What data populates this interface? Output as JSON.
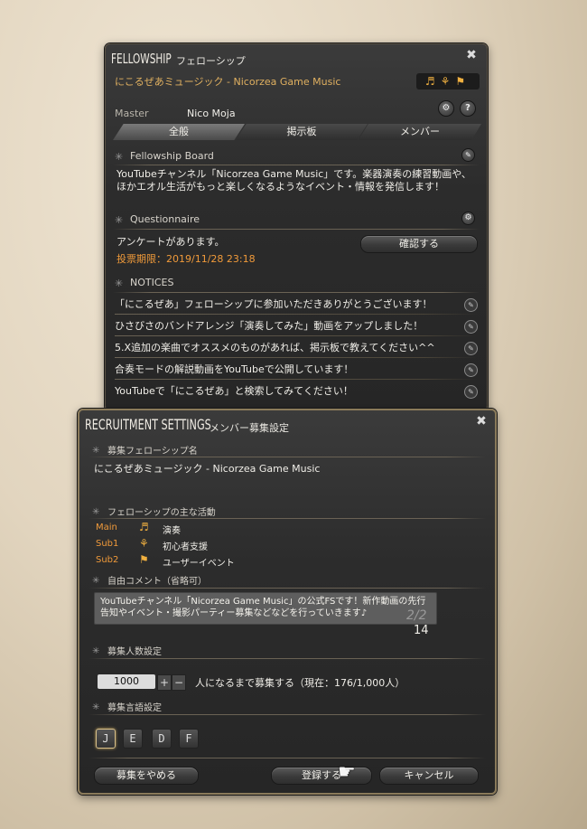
{
  "fellowship": {
    "title": "FELLOWSHIP",
    "title_jp": "フェローシップ",
    "name": "にこるぜあミュージック - Nicorzea Game Music",
    "master_label": "Master",
    "master_name": "Nico Moja",
    "tabs": [
      {
        "label": "全般",
        "active": true
      },
      {
        "label": "掲示板",
        "active": false
      },
      {
        "label": "メンバー",
        "active": false
      }
    ],
    "board": {
      "header": "Fellowship Board",
      "text": "YouTubeチャンネル「Nicorzea Game Music」です。楽器演奏の練習動画や、ほかエオル生活がもっと楽しくなるようなイベント・情報を発信します！"
    },
    "questionnaire": {
      "header": "Questionnaire",
      "text": "アンケートがあります。",
      "deadline": "投票期限：2019/11/28 23:18",
      "confirm_label": "確認する"
    },
    "notices": {
      "header": "NOTICES",
      "items": [
        "「にこるぜあ」フェローシップに参加いただきありがとうございます！",
        "ひさびさのバンドアレンジ「演奏してみた」動画をアップしました！",
        "5.X追加の楽曲でオススメのものがあれば、掲示板で教えてください^^",
        "合奏モードの解説動画をYouTubeで公開しています！",
        "YouTubeで「にこるぜあ」と検索してみてください！"
      ]
    }
  },
  "recruit": {
    "title": "RECRUITMENT SETTINGS",
    "title_jp": "メンバー募集設定",
    "name_header": "募集フェローシップ名",
    "name_value": "にこるぜあミュージック - Nicorzea Game Music",
    "activity_header": "フェローシップの主な活動",
    "activities": [
      {
        "slot": "Main",
        "icon": "music-note-icon",
        "label": "演奏"
      },
      {
        "slot": "Sub1",
        "icon": "sprout-icon",
        "label": "初心者支援"
      },
      {
        "slot": "Sub2",
        "icon": "event-flag-icon",
        "label": "ユーザーイベント"
      }
    ],
    "comment_header": "自由コメント（省略可）",
    "comment_text": "YouTubeチャンネル「Nicorzea Game Music」の公式FSです！新作動画の先行告知やイベント・撮影パーティー募集などなどを行っていきます♪",
    "page_indicator": "2/2",
    "char_count": "14",
    "count_header": "募集人数設定",
    "count_value": "1000",
    "count_text": "人になるまで募集する（現在：176/1,000人）",
    "lang_header": "募集言語設定",
    "languages": [
      "J",
      "E",
      "D",
      "F"
    ],
    "stop_label": "募集をやめる",
    "register_label": "登録する",
    "cancel_label": "キャンセル"
  },
  "colors": {
    "gold": "#e0b060",
    "orange": "#f09a3a",
    "panel": "#2c2c2c"
  }
}
